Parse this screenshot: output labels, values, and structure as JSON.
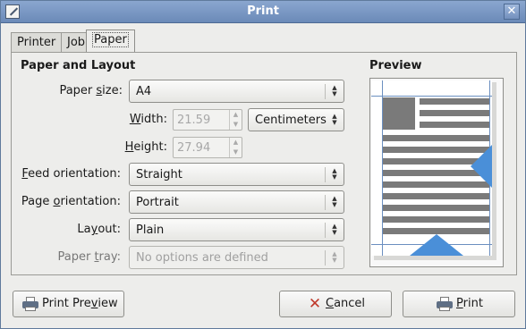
{
  "window": {
    "title": "Print"
  },
  "tabs": [
    {
      "label": "Printer"
    },
    {
      "label": "Job"
    },
    {
      "label": "Paper"
    }
  ],
  "paper_layout": {
    "title": "Paper and Layout",
    "paper_size": {
      "label_pre": "Paper ",
      "label_mnemonic": "s",
      "label_post": "ize:",
      "value": "A4"
    },
    "width": {
      "label_mnemonic": "W",
      "label_post": "idth:",
      "value": "21.59",
      "unit": "Centimeters"
    },
    "height": {
      "label_mnemonic": "H",
      "label_post": "eight:",
      "value": "27.94"
    },
    "feed_orientation": {
      "label_mnemonic": "F",
      "label_post": "eed orientation:",
      "value": "Straight"
    },
    "page_orientation": {
      "label_pre": "Page ",
      "label_mnemonic": "o",
      "label_post": "rientation:",
      "value": "Portrait"
    },
    "layout": {
      "label_pre": "La",
      "label_mnemonic": "y",
      "label_post": "out:",
      "value": "Plain"
    },
    "paper_tray": {
      "label_pre": "Paper ",
      "label_mnemonic": "t",
      "label_post": "ray:",
      "value": "No options are defined"
    }
  },
  "preview": {
    "title": "Preview"
  },
  "buttons": {
    "print_preview": {
      "pre": "Print Pre",
      "mnemonic": "v",
      "post": "iew"
    },
    "cancel": {
      "mnemonic": "C",
      "post": "ancel"
    },
    "print": {
      "mnemonic": "P",
      "post": "rint"
    }
  },
  "colors": {
    "titlebar": "#7b98c6",
    "accent": "#4a8fd8",
    "page_text": "#7a7a7a"
  }
}
